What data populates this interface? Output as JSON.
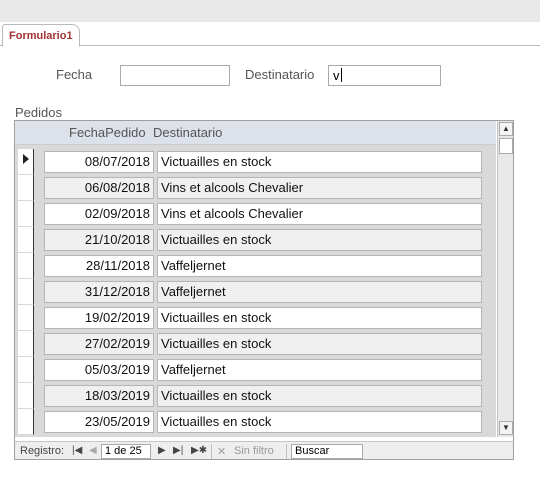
{
  "tab": {
    "label": "Formulario1"
  },
  "filters": {
    "fecha_label": "Fecha",
    "fecha_value": "",
    "destinatario_label": "Destinatario",
    "destinatario_value": "v"
  },
  "subform": {
    "label": "Pedidos",
    "columns": [
      "FechaPedido",
      "Destinatario"
    ],
    "rows": [
      {
        "fecha": "08/07/2018",
        "destinatario": "Victuailles en stock"
      },
      {
        "fecha": "06/08/2018",
        "destinatario": "Vins et alcools Chevalier"
      },
      {
        "fecha": "02/09/2018",
        "destinatario": "Vins et alcools Chevalier"
      },
      {
        "fecha": "21/10/2018",
        "destinatario": "Victuailles en stock"
      },
      {
        "fecha": "28/11/2018",
        "destinatario": "Vaffeljernet"
      },
      {
        "fecha": "31/12/2018",
        "destinatario": "Vaffeljernet"
      },
      {
        "fecha": "19/02/2019",
        "destinatario": "Victuailles en stock"
      },
      {
        "fecha": "27/02/2019",
        "destinatario": "Victuailles en stock"
      },
      {
        "fecha": "05/03/2019",
        "destinatario": "Vaffeljernet"
      },
      {
        "fecha": "18/03/2019",
        "destinatario": "Victuailles en stock"
      },
      {
        "fecha": "23/05/2019",
        "destinatario": "Victuailles en stock"
      }
    ]
  },
  "navigation": {
    "registro_label": "Registro:",
    "record_position": "1 de 25",
    "filter_label": "Sin filtro",
    "search_label": "Buscar"
  },
  "colors": {
    "tab_text": "#a33232",
    "header_bg": "#dce1ea"
  }
}
